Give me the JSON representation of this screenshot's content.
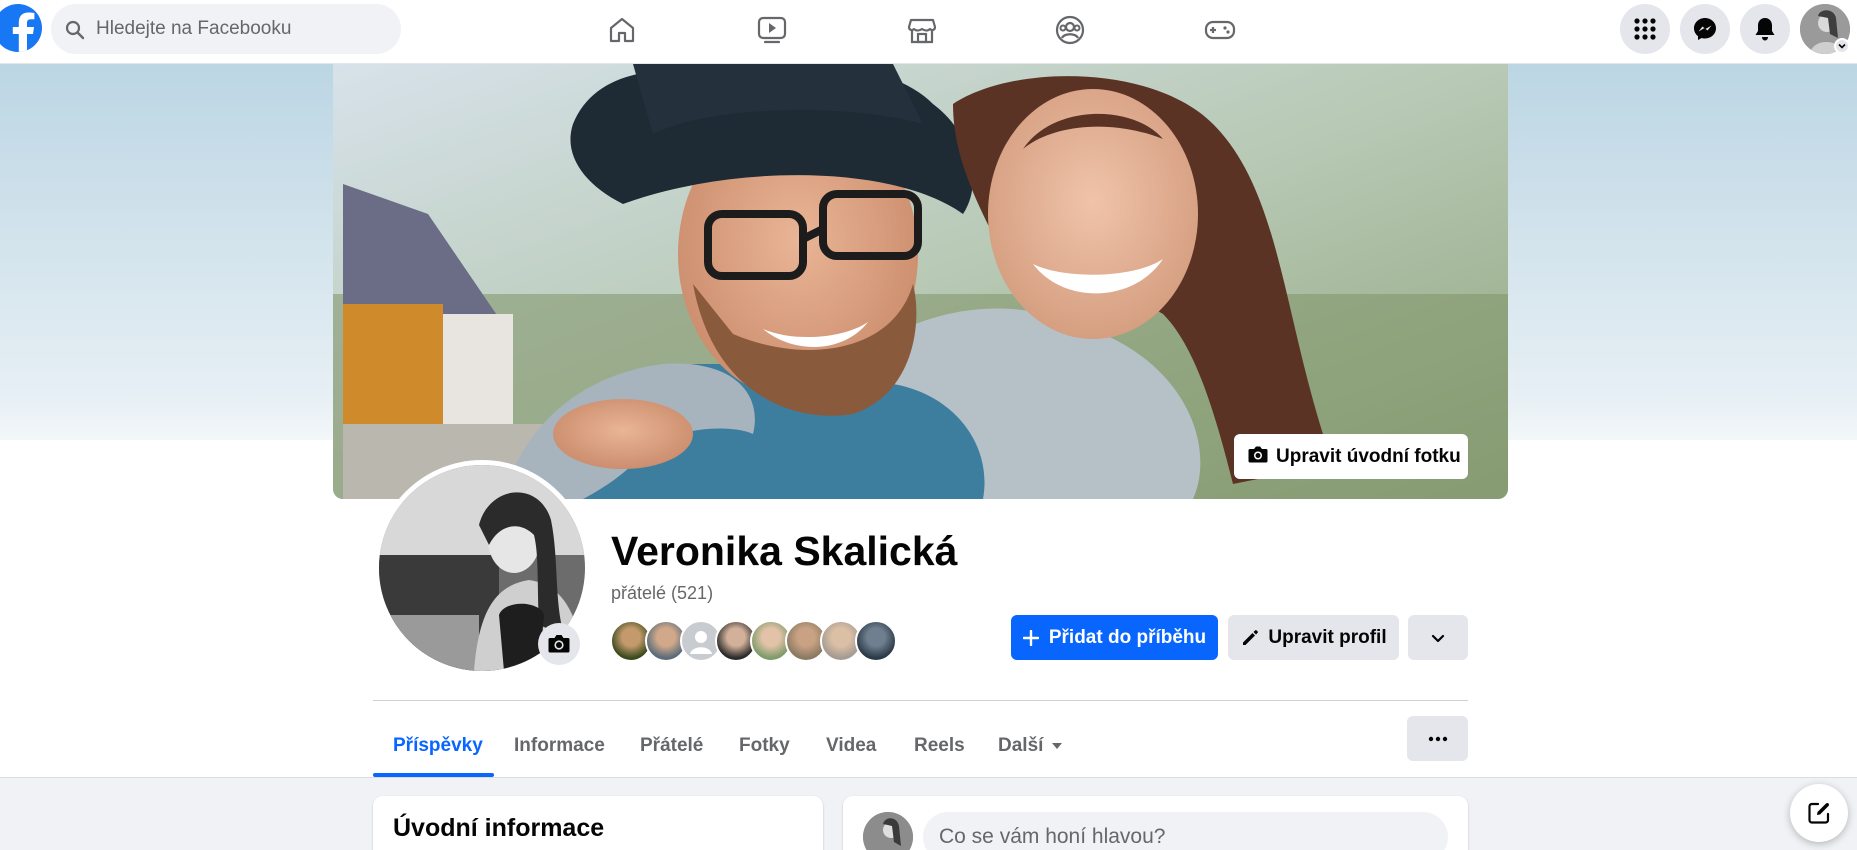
{
  "search": {
    "placeholder": "Hledejte na Facebooku"
  },
  "nav": {
    "icons": [
      "home-icon",
      "video-icon",
      "marketplace-icon",
      "groups-icon",
      "gaming-icon"
    ],
    "right_icons": [
      "menu-grid-icon",
      "messenger-icon",
      "notifications-icon"
    ]
  },
  "cover": {
    "edit_label": "Upravit úvodní fotku"
  },
  "profile": {
    "name": "Veronika Skalická",
    "friends_label": "přátelé (521)",
    "add_story_label": "Přidat do příběhu",
    "edit_profile_label": "Upravit profil"
  },
  "tabs": [
    {
      "label": "Příspěvky",
      "active": true
    },
    {
      "label": "Informace"
    },
    {
      "label": "Přátelé"
    },
    {
      "label": "Fotky"
    },
    {
      "label": "Videa"
    },
    {
      "label": "Reels"
    },
    {
      "label": "Další"
    }
  ],
  "intro": {
    "title": "Úvodní informace"
  },
  "composer": {
    "placeholder": "Co se vám honí hlavou?"
  },
  "colors": {
    "accent": "#0866ff",
    "brand": "#1877f2",
    "secondary_button": "#e4e6eb"
  }
}
